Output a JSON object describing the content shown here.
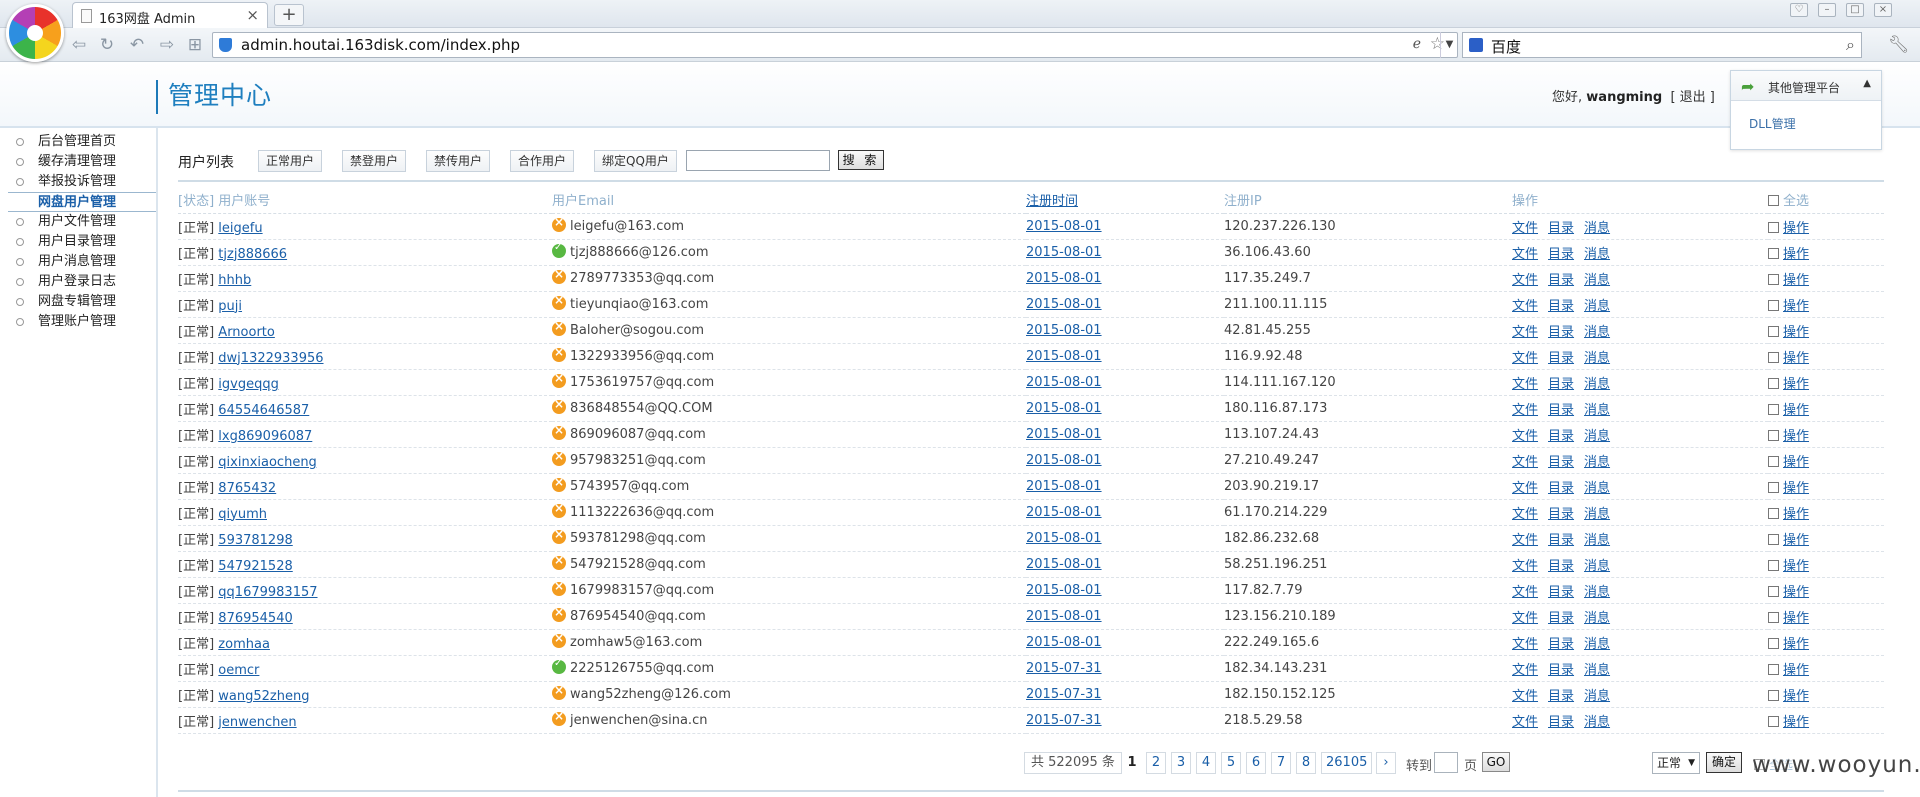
{
  "browser": {
    "tab_title": "163网盘 Admin",
    "url": "admin.houtai.163disk.com/index.php",
    "search_engine": "百度"
  },
  "header": {
    "title": "管理中心",
    "greeting_prefix": "您好,",
    "username": "wangming",
    "logout_label": "退出",
    "other_platform_label": "其他管理平台",
    "dll_label": "DLL管理"
  },
  "sidebar": {
    "items": [
      {
        "label": "后台管理首页"
      },
      {
        "label": "缓存清理管理"
      },
      {
        "label": "举报投诉管理"
      },
      {
        "label": "网盘用户管理"
      },
      {
        "label": "用户文件管理"
      },
      {
        "label": "用户目录管理"
      },
      {
        "label": "用户消息管理"
      },
      {
        "label": "用户登录日志"
      },
      {
        "label": "网盘专辑管理"
      },
      {
        "label": "管理账户管理"
      }
    ],
    "active_index": 3
  },
  "toolbar": {
    "title": "用户列表",
    "filters": [
      "正常用户",
      "禁登用户",
      "禁传用户",
      "合作用户",
      "绑定QQ用户"
    ],
    "search_value": "",
    "search_label": "搜 索"
  },
  "table": {
    "headers": {
      "account": "[状态] 用户账号",
      "email": "用户Email",
      "time": "注册时间",
      "ip": "注册IP",
      "op": "操作",
      "select_all": "全选"
    },
    "ops": [
      "文件",
      "目录",
      "消息"
    ],
    "row_action": "操作",
    "rows": [
      {
        "status": "[正常]",
        "account": "leigefu",
        "email": "leigefu@163.com",
        "verified": false,
        "time": "2015-08-01",
        "ip": "120.237.226.130"
      },
      {
        "status": "[正常]",
        "account": "tjzj888666",
        "email": "tjzj888666@126.com",
        "verified": true,
        "time": "2015-08-01",
        "ip": "36.106.43.60"
      },
      {
        "status": "[正常]",
        "account": "hhhb",
        "email": "2789773353@qq.com",
        "verified": false,
        "time": "2015-08-01",
        "ip": "117.35.249.7"
      },
      {
        "status": "[正常]",
        "account": "puji",
        "email": "tieyunqiao@163.com",
        "verified": false,
        "time": "2015-08-01",
        "ip": "211.100.11.115"
      },
      {
        "status": "[正常]",
        "account": "Arnoorto",
        "email": "Baloher@sogou.com",
        "verified": false,
        "time": "2015-08-01",
        "ip": "42.81.45.255"
      },
      {
        "status": "[正常]",
        "account": "dwj1322933956",
        "email": "1322933956@qq.com",
        "verified": false,
        "time": "2015-08-01",
        "ip": "116.9.92.48"
      },
      {
        "status": "[正常]",
        "account": "igvgeqqg",
        "email": "1753619757@qq.com",
        "verified": false,
        "time": "2015-08-01",
        "ip": "114.111.167.120"
      },
      {
        "status": "[正常]",
        "account": "64554646587",
        "email": "836848554@QQ.COM",
        "verified": false,
        "time": "2015-08-01",
        "ip": "180.116.87.173"
      },
      {
        "status": "[正常]",
        "account": "lxg869096087",
        "email": "869096087@qq.com",
        "verified": false,
        "time": "2015-08-01",
        "ip": "113.107.24.43"
      },
      {
        "status": "[正常]",
        "account": "qixinxiaocheng",
        "email": "957983251@qq.com",
        "verified": false,
        "time": "2015-08-01",
        "ip": "27.210.49.247"
      },
      {
        "status": "[正常]",
        "account": "8765432",
        "email": "5743957@qq.com",
        "verified": false,
        "time": "2015-08-01",
        "ip": "203.90.219.17"
      },
      {
        "status": "[正常]",
        "account": "qiyumh",
        "email": "1113222636@qq.com",
        "verified": false,
        "time": "2015-08-01",
        "ip": "61.170.214.229"
      },
      {
        "status": "[正常]",
        "account": "593781298",
        "email": "593781298@qq.com",
        "verified": false,
        "time": "2015-08-01",
        "ip": "182.86.232.68"
      },
      {
        "status": "[正常]",
        "account": "547921528",
        "email": "547921528@qq.com",
        "verified": false,
        "time": "2015-08-01",
        "ip": "58.251.196.251"
      },
      {
        "status": "[正常]",
        "account": "qq1679983157",
        "email": "1679983157@qq.com",
        "verified": false,
        "time": "2015-08-01",
        "ip": "117.82.7.79"
      },
      {
        "status": "[正常]",
        "account": "876954540",
        "email": "876954540@qq.com",
        "verified": false,
        "time": "2015-08-01",
        "ip": "123.156.210.189"
      },
      {
        "status": "[正常]",
        "account": "zomhaa",
        "email": "zomhaw5@163.com",
        "verified": false,
        "time": "2015-08-01",
        "ip": "222.249.165.6"
      },
      {
        "status": "[正常]",
        "account": "oemcr",
        "email": "2225126755@qq.com",
        "verified": true,
        "time": "2015-07-31",
        "ip": "182.34.143.231"
      },
      {
        "status": "[正常]",
        "account": "wang52zheng",
        "email": "wang52zheng@126.com",
        "verified": false,
        "time": "2015-07-31",
        "ip": "182.150.152.125"
      },
      {
        "status": "[正常]",
        "account": "jenwenchen",
        "email": "jenwenchen@sina.cn",
        "verified": false,
        "time": "2015-07-31",
        "ip": "218.5.29.58"
      }
    ]
  },
  "pagination": {
    "total": "共 522095 条",
    "pages": [
      "1",
      "2",
      "3",
      "4",
      "5",
      "6",
      "7",
      "8",
      "26105"
    ],
    "current": "1",
    "next": "›",
    "jump_prefix": "转到",
    "jump_suffix": "页",
    "go_label": "GO"
  },
  "bulk": {
    "status_value": "正常",
    "confirm_label": "确定",
    "select_all": "全选"
  },
  "watermark": "www.wooyun.org"
}
